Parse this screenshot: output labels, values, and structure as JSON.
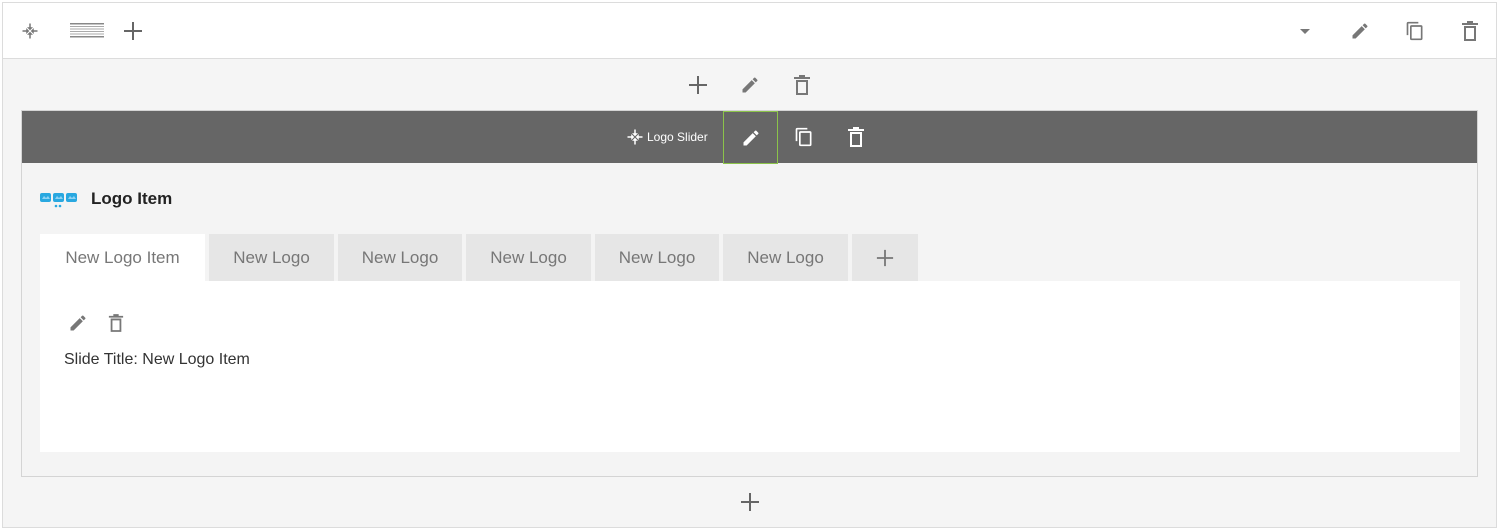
{
  "module": {
    "name": "Logo Slider",
    "item_title": "Logo Item"
  },
  "tabs": [
    {
      "label": "New Logo Item",
      "active": true
    },
    {
      "label": "New Logo",
      "active": false
    },
    {
      "label": "New Logo",
      "active": false
    },
    {
      "label": "New Logo",
      "active": false
    },
    {
      "label": "New Logo",
      "active": false
    },
    {
      "label": "New Logo",
      "active": false
    }
  ],
  "panel": {
    "slide_title_label": "Slide Title:",
    "slide_title_value": "New Logo Item"
  },
  "icons": {
    "row_toolbar": [
      "move-icon",
      "layout-columns-icon",
      "add-icon",
      "dropdown-arrow-icon",
      "edit-icon",
      "copy-icon",
      "delete-icon"
    ],
    "column_toolbar": [
      "add-icon",
      "edit-icon",
      "delete-icon"
    ],
    "module_toolbar": [
      "move-icon",
      "edit-icon",
      "copy-icon",
      "delete-icon"
    ],
    "item_logo": "logo-slider-icon",
    "panel_toolbar": [
      "edit-icon",
      "delete-icon"
    ],
    "bottom": "add-icon"
  },
  "colors": {
    "module_bar": "#666666",
    "active_highlight": "#8bc34a",
    "logo_icon": "#29a8e0",
    "tab_inactive_bg": "#e6e6e6",
    "icon_gray": "#777777"
  }
}
